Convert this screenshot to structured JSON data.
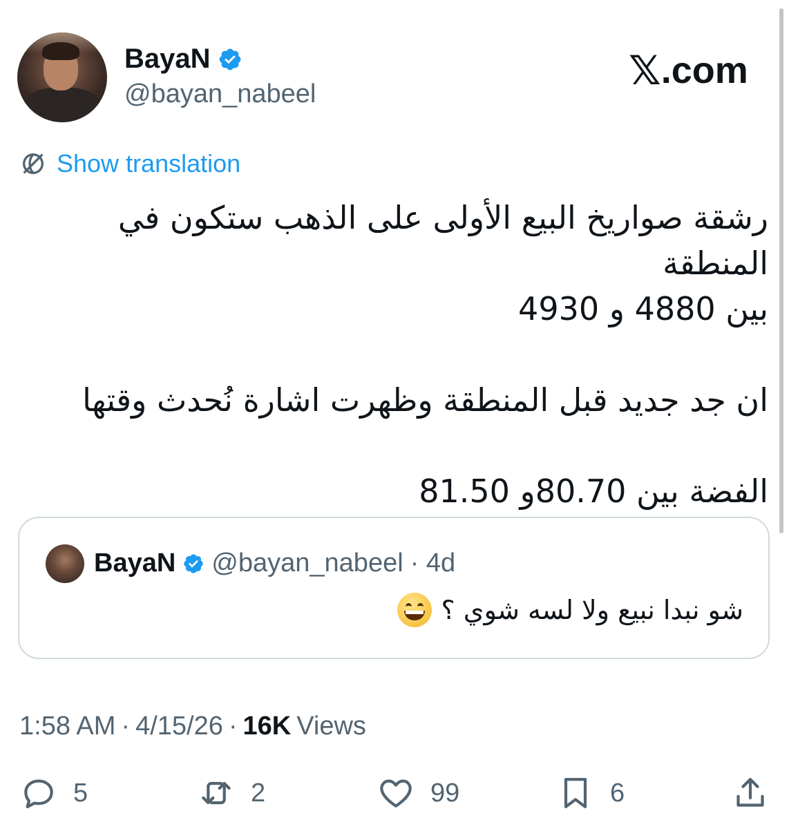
{
  "author": {
    "name": "BayaN",
    "handle": "@bayan_nabeel"
  },
  "brand": {
    "label": ".com"
  },
  "translation": {
    "label": "Show translation"
  },
  "tweet": {
    "text": "رشقة صواريخ البيع الأولى على الذهب ستكون في المنطقة\nبين 4880 و 4930\n\nان جد جديد قبل المنطقة وظهرت اشارة نُحدث وقتها\n\nالفضة بين 80.70و 81.50"
  },
  "quoted": {
    "name": "BayaN",
    "handle": "@bayan_nabeel",
    "age": "· 4d",
    "text": "شو نبدا نبيع ولا لسه شوي ؟",
    "emoji": "grinning-face-icon"
  },
  "meta": {
    "time": "1:58 AM",
    "sep1": "·",
    "date": "4/15/26",
    "sep2": "·",
    "views_count": "16K",
    "views_label": "Views"
  },
  "actions": {
    "replies": "5",
    "reposts": "2",
    "likes": "99",
    "bookmarks": "6"
  },
  "colors": {
    "accent": "#1d9bf0",
    "text": "#0f1419",
    "muted": "#536471"
  }
}
